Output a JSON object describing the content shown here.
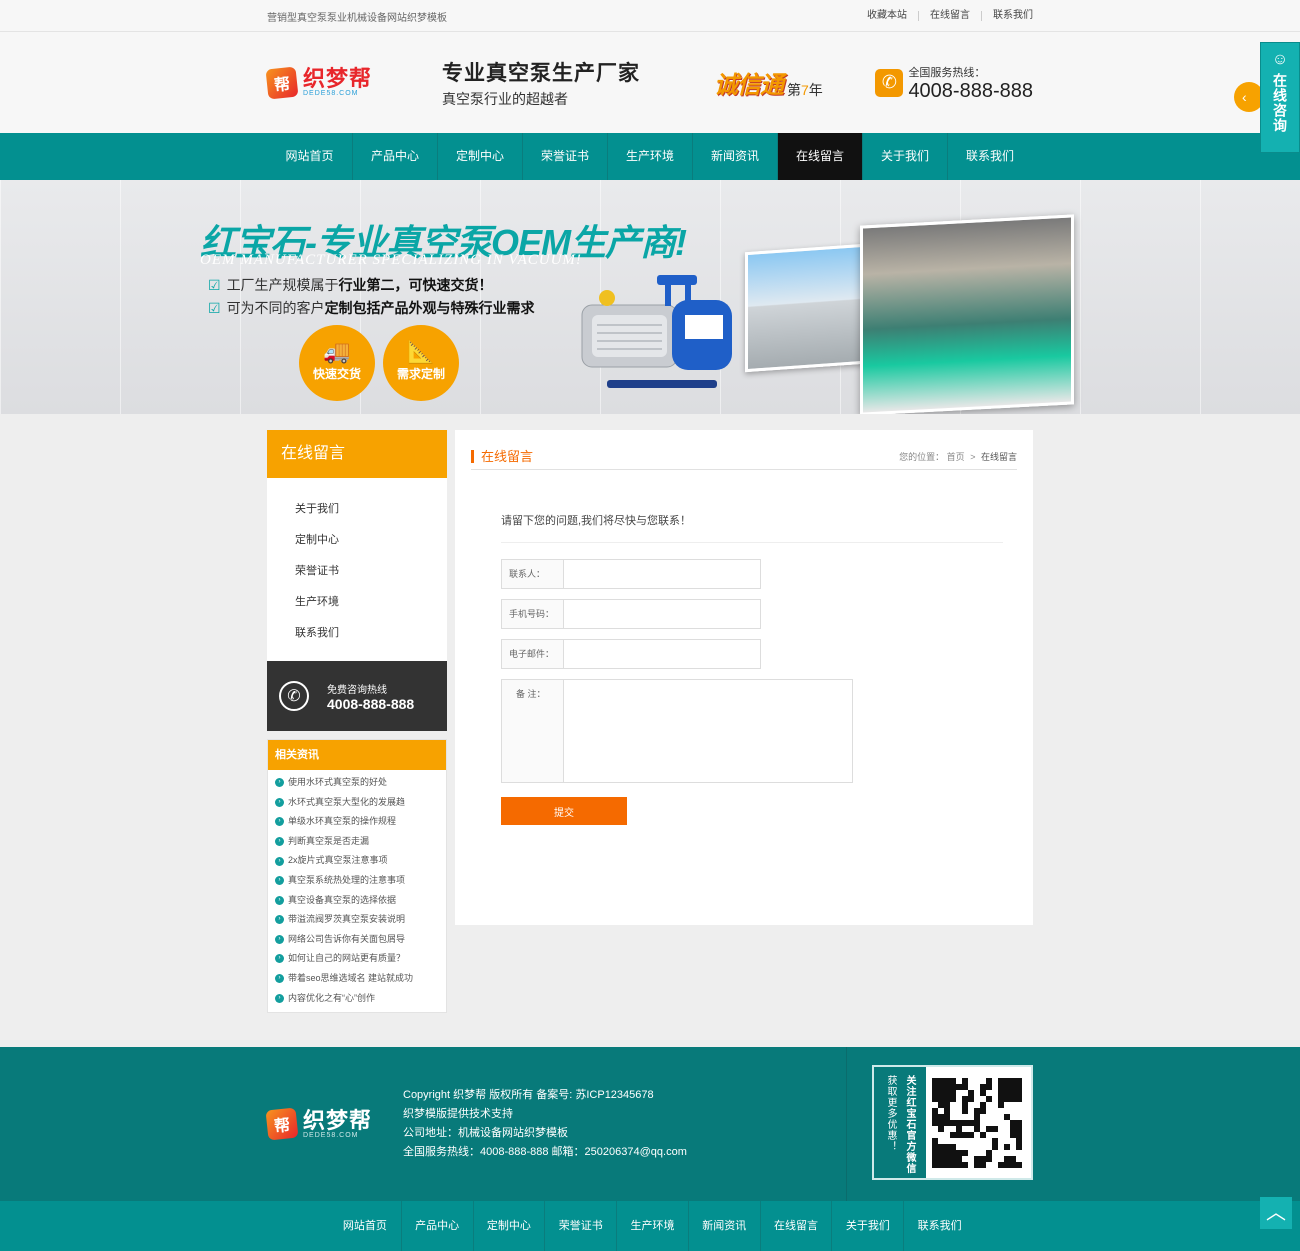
{
  "topbar": {
    "slogan": "营销型真空泵泵业机械设备网站织梦模板",
    "links": [
      "收藏本站",
      "在线留言",
      "联系我们"
    ]
  },
  "header": {
    "logo_mark": "帮",
    "logo_text": "织梦帮",
    "logo_en": "DEDE58.COM",
    "title": "专业真空泵生产厂家",
    "subtitle": "真空泵行业的超越者",
    "cxt_badge": "诚信通",
    "cxt_years_prefix": "第",
    "cxt_years_num": "7",
    "cxt_years_suffix": "年",
    "hotline_label": "全国服务热线：",
    "hotline_number": "4008-888-888"
  },
  "nav": {
    "items": [
      "网站首页",
      "产品中心",
      "定制中心",
      "荣誉证书",
      "生产环境",
      "新闻资讯",
      "在线留言",
      "关于我们",
      "联系我们"
    ],
    "active_index": 6
  },
  "banner": {
    "title": "红宝石-专业真空泵OEM生产商!",
    "subtitle_en": "OEM MANUFACTURER SPECIALIZING IN VACUUM!",
    "point1_pre": "工厂生产规模属于",
    "point1_bold": "行业第二，可快速交货！",
    "point2_pre": "可为不同的客户",
    "point2_bold": "定制包括产品外观与特殊行业需求",
    "circle1": "快速交货",
    "circle2": "需求定制"
  },
  "sidebar": {
    "heading": "在线留言",
    "menu": [
      "关于我们",
      "定制中心",
      "荣誉证书",
      "生产环境",
      "联系我们"
    ],
    "phone_label": "免费咨询热线",
    "phone_number": "4008-888-888",
    "news_heading": "相关资讯",
    "news": [
      "使用水环式真空泵的好处",
      "水环式真空泵大型化的发展趋",
      "单级水环真空泵的操作规程",
      "判断真空泵是否走漏",
      "2x旋片式真空泵注意事项",
      "真空泵系统热处理的注意事项",
      "真空设备真空泵的选择依据",
      "带溢流阀罗茨真空泵安装说明",
      "网络公司告诉你有关面包屑导",
      "如何让自己的网站更有质量？",
      "带着seo思维选域名 建站就成功",
      "内容优化之有“心”创作"
    ]
  },
  "content": {
    "title": "在线留言",
    "crumb_label": "您的位置：",
    "crumb_home": "首页",
    "crumb_sep": ">",
    "crumb_current": "在线留言",
    "intro": "请留下您的问题,我们将尽快与您联系！",
    "fields": {
      "contact": "联系人：",
      "mobile": "手机号码：",
      "email": "电子邮件：",
      "note": "备 注："
    },
    "submit": "提交"
  },
  "footer": {
    "logo_mark": "帮",
    "logo_text": "织梦帮",
    "logo_en": "DEDE58.COM",
    "copyright": "Copyright 织梦帮 版权所有  备案号: 苏ICP12345678",
    "support": "织梦模版提供技术支持",
    "address": "公司地址：机械设备网站织梦模板",
    "contact": "全国服务热线：4008-888-888   邮箱：250206374@qq.com",
    "qr_text1": "关注红宝石官方微信",
    "qr_text2": "获取更多优惠！",
    "qr_mark": "帮"
  },
  "bottom_nav": [
    "网站首页",
    "产品中心",
    "定制中心",
    "荣誉证书",
    "生产环境",
    "新闻资讯",
    "在线留言",
    "关于我们",
    "联系我们"
  ],
  "float": {
    "consult": "在线咨询"
  },
  "colors": {
    "teal": "#039090",
    "orange": "#f7a200",
    "accent": "#f56a00"
  }
}
